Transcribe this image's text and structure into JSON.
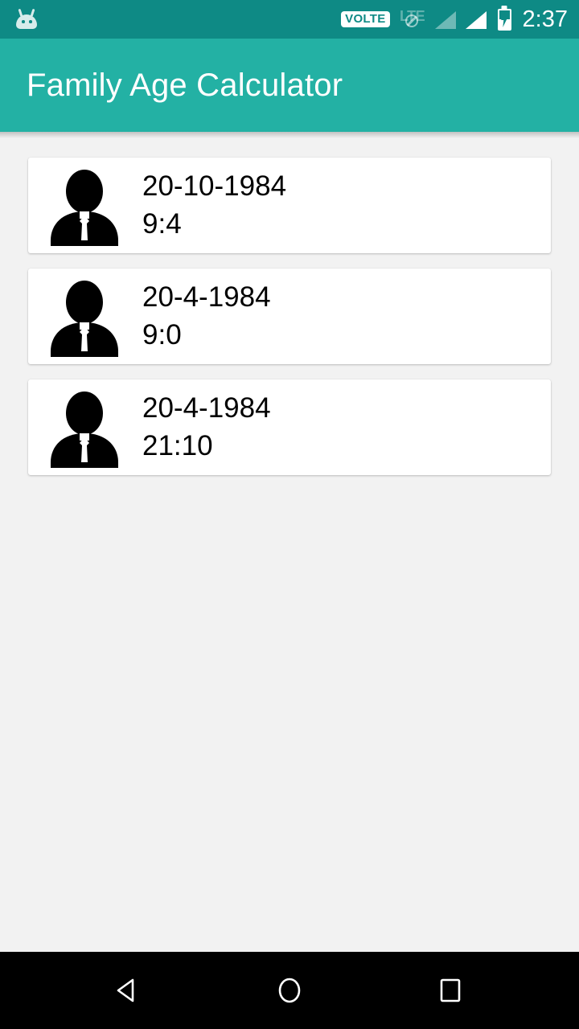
{
  "status_bar": {
    "app_icon": "android-head-icon",
    "volte_label": "VOLTE",
    "network_label": "LTE",
    "network_blocked_icon": "no-data-slash-icon",
    "signal_1_icon": "signal-bars-dim-icon",
    "signal_2_icon": "signal-bars-icon",
    "battery_icon": "battery-charging-icon",
    "time": "2:37",
    "background_color": "#0e8a85"
  },
  "app_bar": {
    "title": "Family Age Calculator",
    "background_color": "#23b1a4",
    "title_color": "#ffffff"
  },
  "content": {
    "background_color": "#f2f2f2",
    "items": [
      {
        "avatar_icon": "person-avatar-icon",
        "date": "20-10-1984",
        "age": "9:4"
      },
      {
        "avatar_icon": "person-avatar-icon",
        "date": "20-4-1984",
        "age": "9:0"
      },
      {
        "avatar_icon": "person-avatar-icon",
        "date": "20-4-1984",
        "age": "21:10"
      }
    ]
  },
  "nav_bar": {
    "background_color": "#000000",
    "back_label": "Back",
    "home_label": "Home",
    "recents_label": "Recents"
  }
}
